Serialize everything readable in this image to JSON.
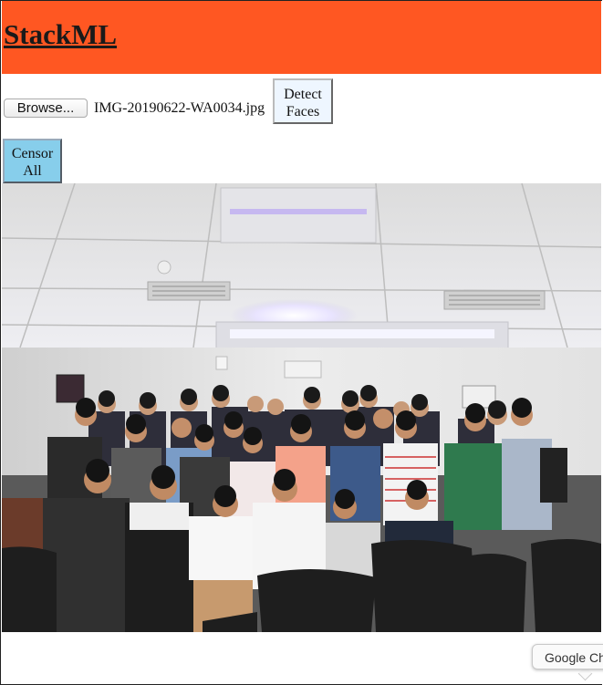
{
  "header": {
    "brand": "StackML"
  },
  "upload": {
    "browse_label": "Browse...",
    "file_name": "IMG-20190622-WA0034.jpg",
    "detect_label_line1": "Detect",
    "detect_label_line2": "Faces"
  },
  "actions": {
    "censor_label_line1": "Censor",
    "censor_label_line2": "All"
  },
  "tooltip": {
    "text": "Google Ch"
  },
  "colors": {
    "header_bg": "#ff5722",
    "censor_bg": "#87ceeb",
    "detect_bg": "#eef6ff"
  }
}
